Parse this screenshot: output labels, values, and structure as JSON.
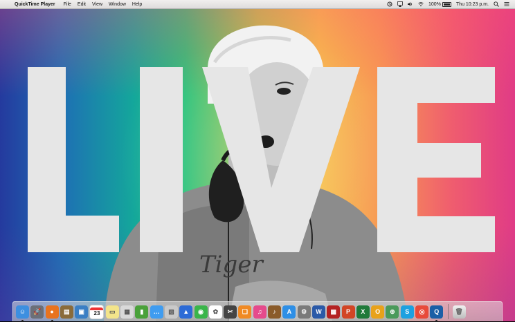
{
  "menubar": {
    "app_name": "QuickTime Player",
    "menus": [
      "File",
      "Edit",
      "View",
      "Window",
      "Help"
    ],
    "battery_text": "100%",
    "clock": "Thu 10:23 p.m."
  },
  "wallpaper": {
    "word": "LIVE",
    "shirt_text": "Tiger"
  },
  "dock": {
    "calendar_day": "23",
    "apps": [
      {
        "name": "finder",
        "color": "#3d8fe0",
        "glyph": "☺"
      },
      {
        "name": "launchpad",
        "color": "#6b6f78",
        "glyph": "🚀"
      },
      {
        "name": "firefox",
        "color": "#e8731f",
        "glyph": "●"
      },
      {
        "name": "notes-book",
        "color": "#8a6b3a",
        "glyph": "▤"
      },
      {
        "name": "preview",
        "color": "#3b7fc4",
        "glyph": "▣"
      },
      {
        "name": "calendar",
        "color": "#ffffff",
        "glyph": ""
      },
      {
        "name": "stickies",
        "color": "#f3e48a",
        "glyph": "▭"
      },
      {
        "name": "photos-viewer",
        "color": "#d9d9d9",
        "glyph": "▦"
      },
      {
        "name": "numbers",
        "color": "#4aa13a",
        "glyph": "▮"
      },
      {
        "name": "messages",
        "color": "#3f9cf0",
        "glyph": "…"
      },
      {
        "name": "image-capture",
        "color": "#c9c9c9",
        "glyph": "▧"
      },
      {
        "name": "keynote",
        "color": "#2d6bd6",
        "glyph": "▲"
      },
      {
        "name": "facetime",
        "color": "#3ab54a",
        "glyph": "◉"
      },
      {
        "name": "photos",
        "color": "#ffffff",
        "glyph": "✿"
      },
      {
        "name": "final-cut",
        "color": "#444",
        "glyph": "✂"
      },
      {
        "name": "ibooks",
        "color": "#f08a24",
        "glyph": "❑"
      },
      {
        "name": "itunes",
        "color": "#e54b8c",
        "glyph": "♫"
      },
      {
        "name": "garageband",
        "color": "#8a5b2a",
        "glyph": "♪"
      },
      {
        "name": "app-store",
        "color": "#2e8fe6",
        "glyph": "A"
      },
      {
        "name": "system-preferences",
        "color": "#7a7a7a",
        "glyph": "⚙"
      },
      {
        "name": "word",
        "color": "#2b5aa8",
        "glyph": "W"
      },
      {
        "name": "photo-booth",
        "color": "#b42222",
        "glyph": "▩"
      },
      {
        "name": "powerpoint",
        "color": "#d24625",
        "glyph": "P"
      },
      {
        "name": "excel",
        "color": "#1f7a3a",
        "glyph": "X"
      },
      {
        "name": "outlook",
        "color": "#e8a21b",
        "glyph": "O"
      },
      {
        "name": "network-utility",
        "color": "#4a9a5a",
        "glyph": "⊕"
      },
      {
        "name": "skype",
        "color": "#1da1e0",
        "glyph": "S"
      },
      {
        "name": "chrome",
        "color": "#e84a3a",
        "glyph": "◎"
      },
      {
        "name": "quicktime",
        "color": "#1b5fa6",
        "glyph": "Q"
      }
    ]
  }
}
